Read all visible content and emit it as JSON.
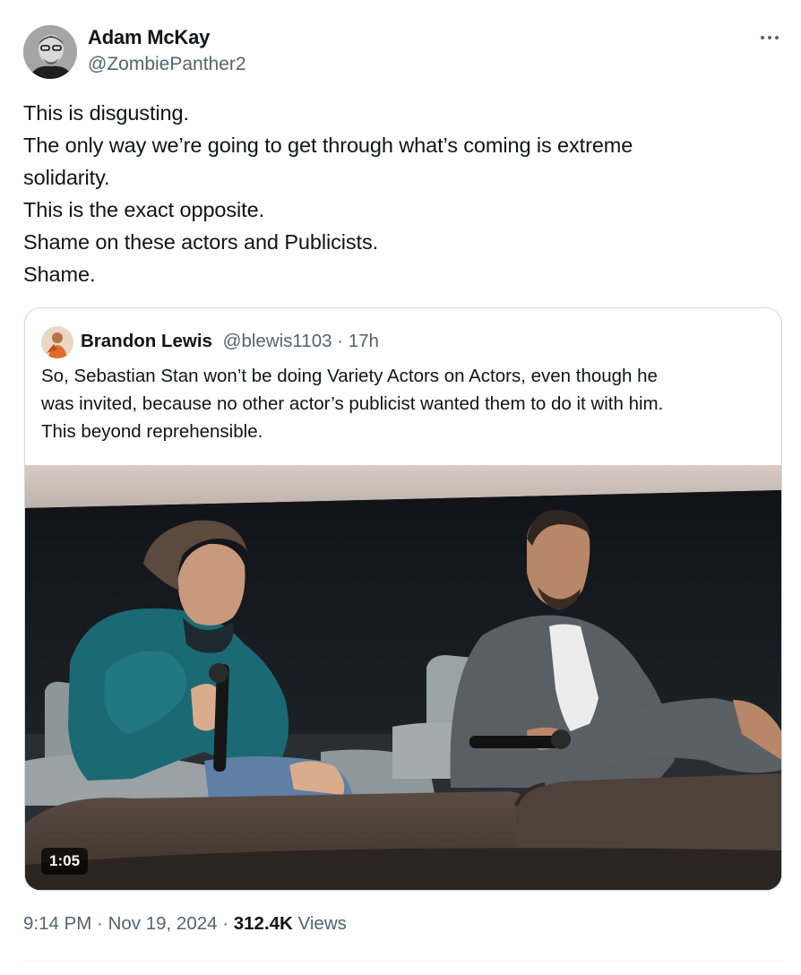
{
  "tweet": {
    "author": {
      "name": "Adam McKay",
      "handle": "@ZombiePanther2"
    },
    "more_icon": "more-horizontal-icon",
    "text_lines": [
      "This is disgusting.",
      "The only way we’re going to get through what’s coming is extreme",
      "solidarity.",
      "This is the exact opposite.",
      "Shame on these actors and Publicists.",
      "Shame."
    ],
    "time": "9:14 PM",
    "date": "Nov 19, 2024",
    "separator": " · ",
    "views_count": "312.4K",
    "views_label": "Views"
  },
  "quote": {
    "author": {
      "name": "Brandon Lewis",
      "handle": "@blewis1103",
      "time": "17h"
    },
    "separator": " · ",
    "text_lines": [
      "So, Sebastian Stan won’t be doing Variety Actors on Actors, even though he",
      "was invited, because no other actor’s publicist wanted them to do it with him.",
      "This beyond reprehensible."
    ],
    "video": {
      "duration": "1:05"
    }
  },
  "colors": {
    "text_primary": "#0f1419",
    "text_secondary": "#536471",
    "border": "#cfd9de",
    "divider": "#eff3f4"
  }
}
